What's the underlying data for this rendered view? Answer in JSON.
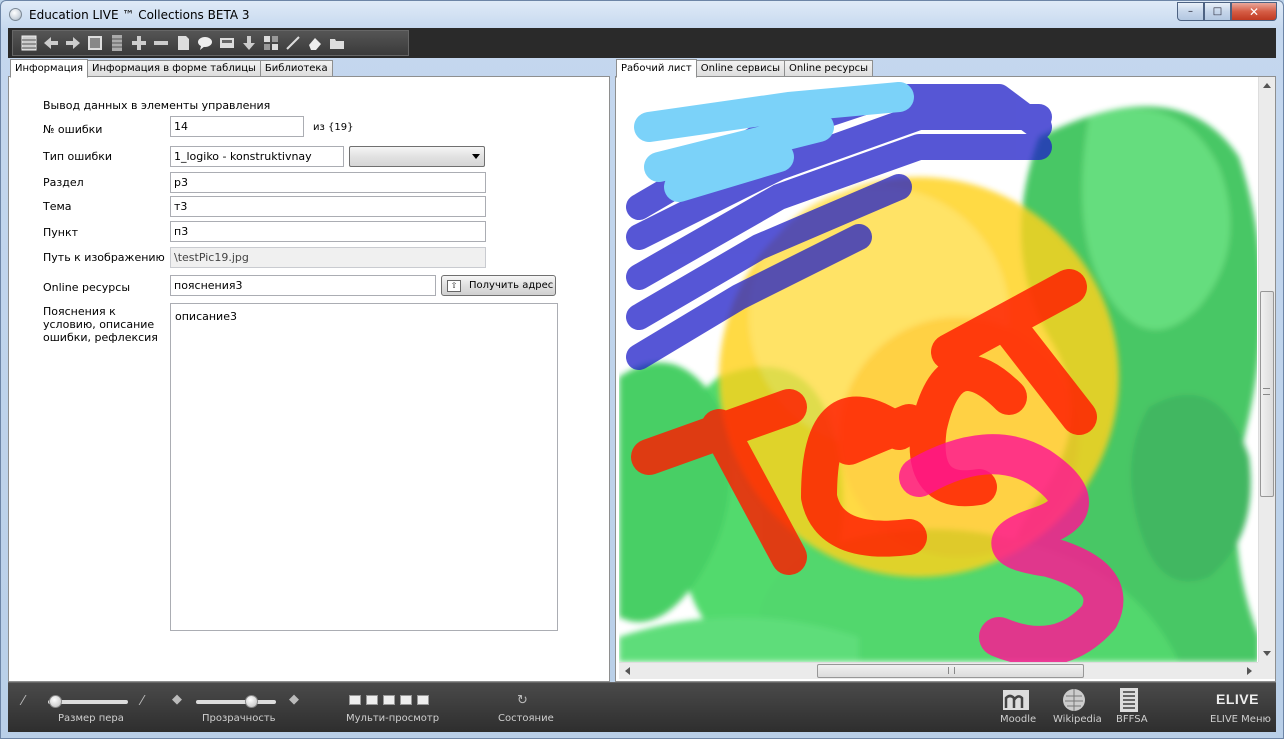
{
  "window": {
    "title": "Education LIVE ™ Collections BETA 3",
    "controls": {
      "minimize": "–",
      "maximize": "□",
      "close": "✕"
    }
  },
  "toolbar": {
    "icons": [
      "table-icon",
      "arrow-left-icon",
      "arrow-right-icon",
      "square-icon",
      "grid-column-icon",
      "plus-icon",
      "minus-icon",
      "page-icon",
      "speech-bubble-icon",
      "card-icon",
      "arrow-down-icon",
      "grid-icon",
      "pen-icon",
      "eraser-icon",
      "folder-icon"
    ]
  },
  "left_tabs": [
    {
      "label": "Информация",
      "active": true
    },
    {
      "label": "Информация в форме таблицы",
      "active": false
    },
    {
      "label": "Библиотека",
      "active": false
    }
  ],
  "right_tabs": [
    {
      "label": "Рабочий лист",
      "active": true
    },
    {
      "label": "Online сервисы",
      "active": false
    },
    {
      "label": "Online ресурсы",
      "active": false
    }
  ],
  "form": {
    "header": "Вывод данных в элементы управления",
    "error_number": {
      "label": "№ ошибки",
      "value": "14",
      "of": "из {19}"
    },
    "error_type": {
      "label": "Тип ошибки",
      "value": "1_logiko - konstruktivnay",
      "combo_value": ""
    },
    "section": {
      "label": "Раздел",
      "value": "р3"
    },
    "topic": {
      "label": "Тема",
      "value": "т3"
    },
    "item": {
      "label": "Пункт",
      "value": "п3"
    },
    "image_path": {
      "label": "Путь к изображению",
      "value": "\\testPic19.jpg"
    },
    "online": {
      "label": "Online ресурсы",
      "value": "пояснения3",
      "button": "Получить адрес"
    },
    "notes": {
      "label": "Пояснения к условию, описание ошибки, рефлексия",
      "value": "описание3"
    }
  },
  "canvas": {
    "drawn_text": "Тест 3",
    "colors": {
      "green": "#1ec83c",
      "yellow": "#ffd21e",
      "blue": "#1e1ec8",
      "lightblue": "#4fc3f7",
      "red": "#ff1a00",
      "pink": "#ff1493"
    }
  },
  "bottombar": {
    "pen_size": {
      "label": "Размер пера",
      "value": 0.02
    },
    "opacity": {
      "label": "Прозрачность",
      "value": 0.73
    },
    "multi_view": {
      "label": "Мульти-просмотр"
    },
    "state": {
      "label": "Состояние"
    },
    "links": [
      {
        "label": "Moodle",
        "icon": "moodle-icon"
      },
      {
        "label": "Wikipedia",
        "icon": "wikipedia-icon"
      },
      {
        "label": "BFFSA",
        "icon": "bffsa-icon"
      }
    ],
    "menu": {
      "logo": "ELIVE",
      "label": "ELIVE Меню"
    }
  }
}
